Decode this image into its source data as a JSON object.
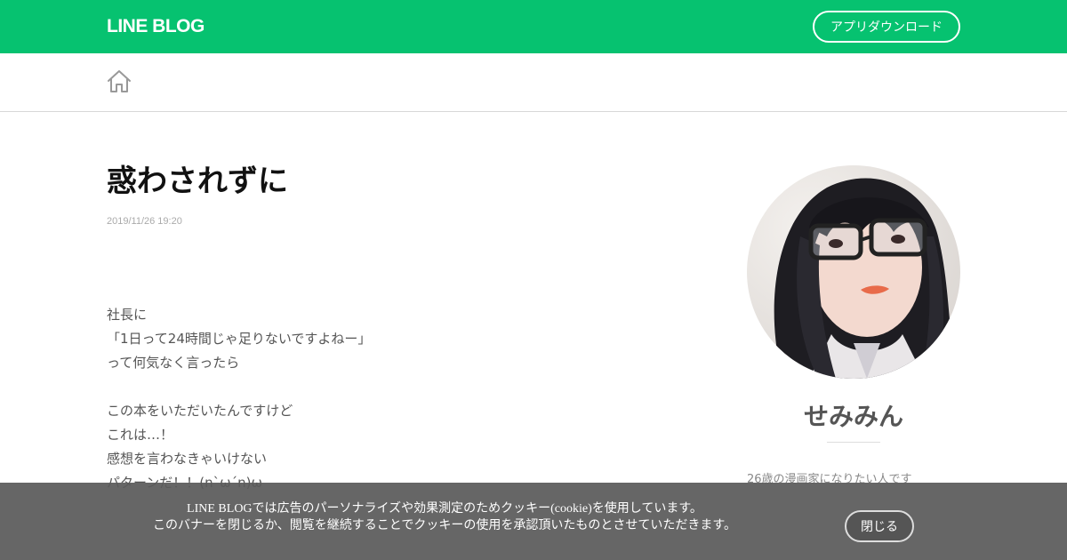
{
  "header": {
    "logo": "LINE BLOG",
    "app_download_label": "アプリダウンロード"
  },
  "nav": {
    "home_icon": "home-icon"
  },
  "post": {
    "title": "惑わされずに",
    "date": "2019/11/26 19:20",
    "body_lines": [
      "社長に",
      "「1日って24時間じゃ足りないですよねー」",
      "って何気なく言ったら",
      "",
      "この本をいただいたんですけど",
      "これは…！",
      "感想を言わなきゃいけない",
      "パターンだ！！(n`ω´n)ω"
    ]
  },
  "author": {
    "name": "せみみん",
    "description": "26歳の漫画家になりたい人です"
  },
  "cookie": {
    "line1": "LINE BLOGでは広告のパーソナライズや効果測定のためクッキー(cookie)を使用しています。",
    "line2": "このバナーを閉じるか、閲覧を継続することでクッキーの使用を承認頂いたものとさせていただきます。",
    "close_label": "閉じる"
  },
  "colors": {
    "brand_green": "#06c270",
    "banner_bg": "#5a5a5a"
  }
}
